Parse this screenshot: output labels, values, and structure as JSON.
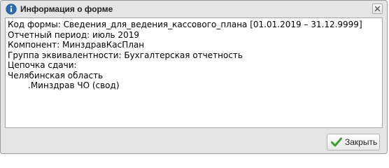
{
  "window": {
    "title": "Информация о форме",
    "close_icon": "close-icon",
    "title_icon": "info-icon"
  },
  "content": {
    "lines": [
      "Код формы: Сведения_для_ведения_кассового_плана [01.01.2019 – 31.12.9999]",
      "Отчетный период: июль 2019",
      "Компонент: МинздравКасПлан",
      "Группа эквивалентности: Бухгалтерская отчетность",
      "Цепочка сдачи:",
      "Челябинская область",
      ".Минздрав ЧО (свод)"
    ]
  },
  "footer": {
    "close_label": "Закрыть",
    "close_icon": "check-icon"
  },
  "colors": {
    "window_bg": "#e5e5e5",
    "info_icon": "#2a6db6",
    "check_icon": "#3aa12e"
  }
}
